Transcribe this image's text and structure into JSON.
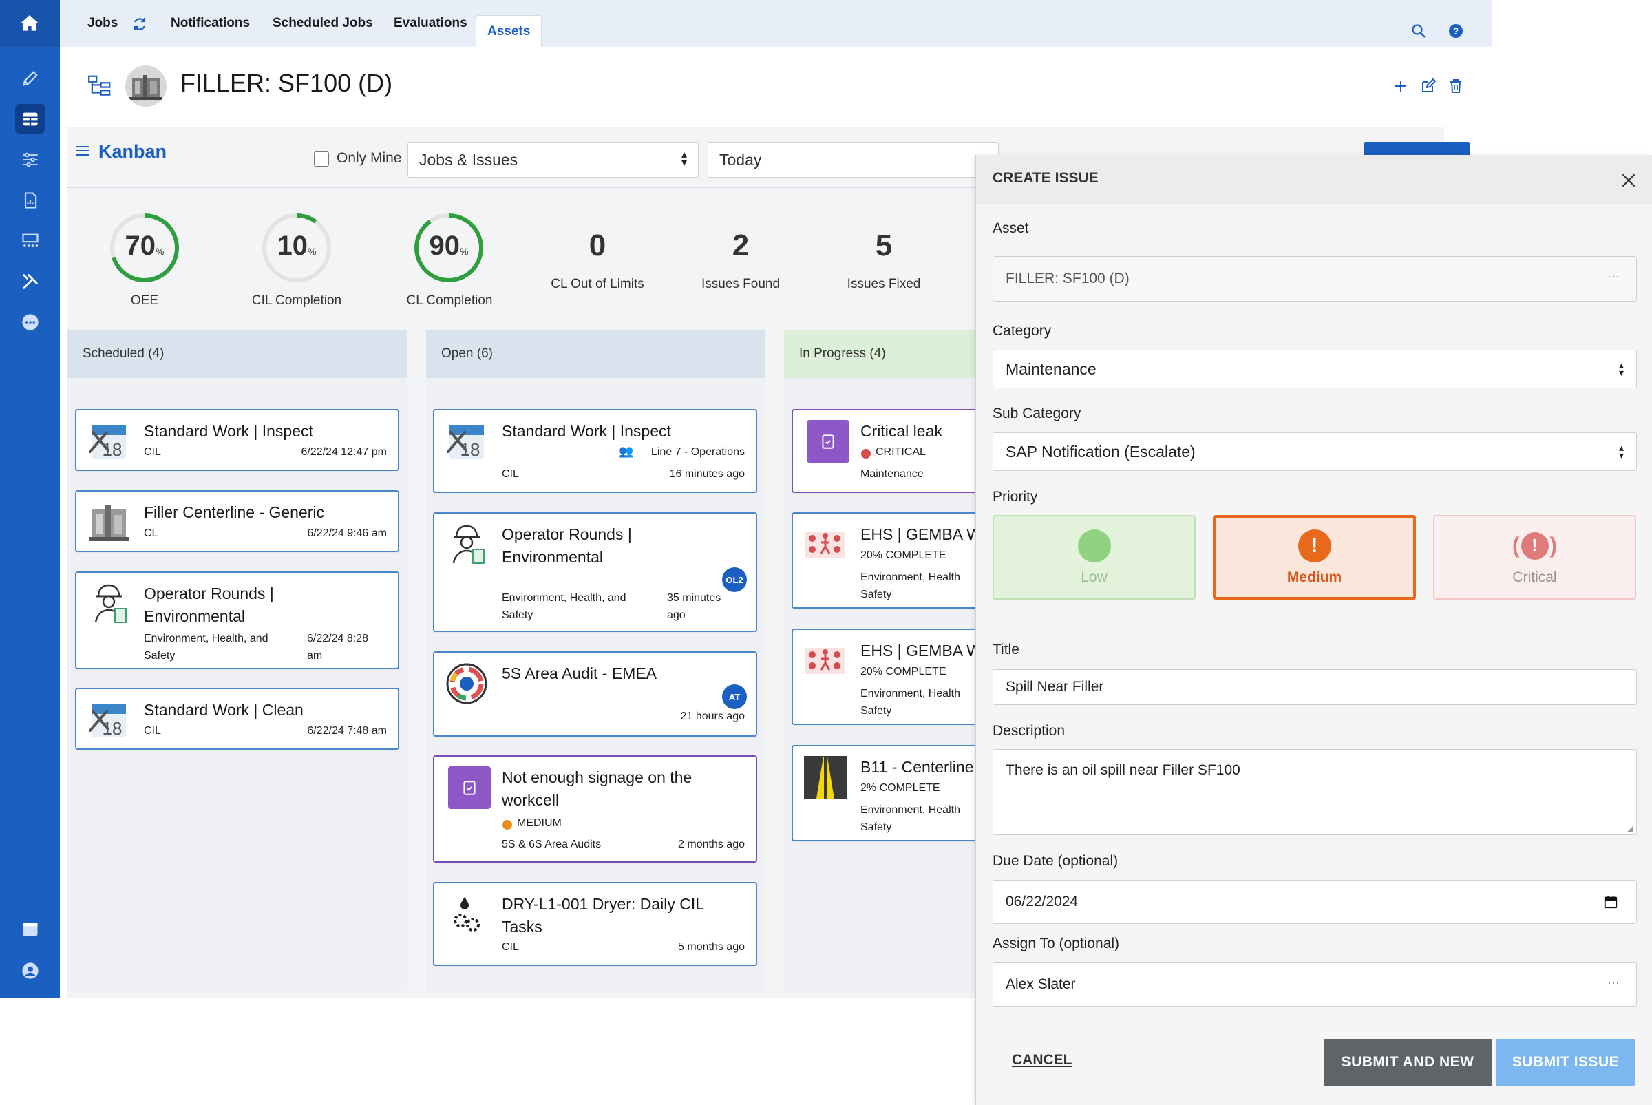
{
  "nav": {
    "tabs": [
      "Jobs",
      "Notifications",
      "Scheduled Jobs",
      "Evaluations",
      "Assets"
    ],
    "active_tab": "Assets"
  },
  "asset": {
    "title": "FILLER: SF100 (D)"
  },
  "toolbar": {
    "view_label": "Kanban",
    "only_mine_label": "Only Mine",
    "filter_select": "Jobs & Issues",
    "date_select": "Today"
  },
  "metrics": {
    "oee": {
      "value": "70",
      "unit": "%",
      "label": "OEE",
      "percent": 70
    },
    "cil": {
      "value": "10",
      "unit": "%",
      "label": "CIL Completion",
      "percent": 10
    },
    "cl": {
      "value": "90",
      "unit": "%",
      "label": "CL Completion",
      "percent": 90
    },
    "out_of_limits": {
      "value": "0",
      "label": "CL Out of Limits"
    },
    "issues_found": {
      "value": "2",
      "label": "Issues Found"
    },
    "issues_fixed": {
      "value": "5",
      "label": "Issues Fixed"
    }
  },
  "columns": {
    "scheduled": {
      "header": "Scheduled (4)",
      "cards": [
        {
          "title": "Standard Work | Inspect",
          "type": "CIL",
          "date": "6/22/24 12:47 pm",
          "icon": "calendar-tools-icon"
        },
        {
          "title": "Filler Centerline - Generic",
          "type": "CL",
          "date": "6/22/24 9:46 am",
          "icon": "machine-thumbnail"
        },
        {
          "title_line1": "Operator Rounds |",
          "title_line2": "Environmental",
          "cat_line1": "Environment, Health, and",
          "cat_line2": "Safety",
          "date_line1": "6/22/24 8:28",
          "date_line2": "am",
          "icon": "operator-icon"
        },
        {
          "title": "Standard Work | Clean",
          "type": "CIL",
          "date": "6/22/24 7:48 am",
          "icon": "calendar-tools-icon"
        }
      ]
    },
    "open": {
      "header": "Open (6)",
      "cards": [
        {
          "title": "Standard Work | Inspect",
          "line": "Line 7 - Operations",
          "type": "CIL",
          "time": "16 minutes ago"
        },
        {
          "title_line1": "Operator Rounds |",
          "title_line2": "Environmental",
          "badge": "OL2",
          "cat_line1": "Environment, Health, and",
          "cat_line2": "Safety",
          "time_line1": "35 minutes",
          "time_line2": "ago"
        },
        {
          "title": "5S Area Audit - EMEA",
          "badge": "AT",
          "time": "21 hours ago"
        },
        {
          "title_line1": "Not enough signage on the",
          "title_line2": "workcell",
          "priority": "MEDIUM",
          "category": "5S & 6S Area Audits",
          "time": "2 months ago"
        },
        {
          "title_line1": "DRY-L1-001 Dryer: Daily CIL",
          "title_line2": "Tasks",
          "type": "CIL",
          "time": "5 months ago"
        }
      ]
    },
    "in_progress": {
      "header": "In Progress (4)",
      "cards": [
        {
          "title": "Critical leak",
          "priority": "CRITICAL",
          "category": "Maintenance"
        },
        {
          "title": "EHS | GEMBA W",
          "progress": "20% COMPLETE",
          "cat_line1": "Environment, Health",
          "cat_line2": "Safety"
        },
        {
          "title": "EHS | GEMBA W",
          "progress": "20% COMPLETE",
          "cat_line1": "Environment, Health",
          "cat_line2": "Safety"
        },
        {
          "title": "B11 - Centerline",
          "progress": "2% COMPLETE",
          "cat_line1": "Environment, Health",
          "cat_line2": "Safety"
        }
      ]
    }
  },
  "create_issue": {
    "heading": "CREATE ISSUE",
    "asset_label": "Asset",
    "asset_value": "FILLER: SF100 (D)",
    "category_label": "Category",
    "category_value": "Maintenance",
    "subcategory_label": "Sub Category",
    "subcategory_value": "SAP Notification (Escalate)",
    "priority_label": "Priority",
    "priorities": [
      "Low",
      "Medium",
      "Critical"
    ],
    "selected_priority": "Medium",
    "title_label": "Title",
    "title_value": "Spill Near Filler",
    "description_label": "Description",
    "description_value": "There is an oil spill near Filler SF100",
    "due_label": "Due Date (optional)",
    "due_value": "06/22/2024",
    "assign_label": "Assign To (optional)",
    "assign_value": "Alex Slater",
    "cancel": "CANCEL",
    "submit_new": "SUBMIT AND NEW",
    "submit": "SUBMIT ISSUE"
  },
  "colors": {
    "brand": "#1b5fc1",
    "gauge_green": "#2e9e3e",
    "medium_orange": "#e8691c",
    "critical_red": "#d64b4b",
    "low_green": "#8fd27f"
  }
}
